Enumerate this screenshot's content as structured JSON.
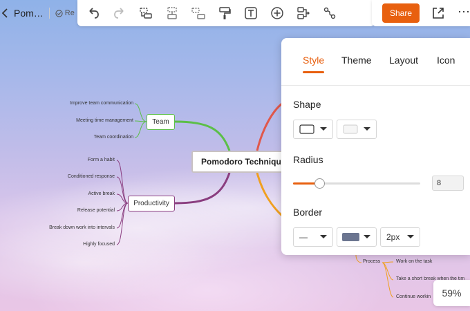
{
  "header": {
    "doc_title": "Pom…",
    "saved_status": "Re"
  },
  "toolbar": {
    "items": [
      "undo-icon",
      "redo-icon",
      "add-topic-icon",
      "add-subtopic-icon",
      "add-floating-topic-icon",
      "format-painter-icon",
      "text-icon",
      "insert-icon",
      "relationship-icon",
      "connector-icon"
    ],
    "share_label": "Share"
  },
  "colors": {
    "accent": "#e8600f",
    "team_branch": "#5cbf48",
    "productivity_branch": "#8a3d7f",
    "red_branch": "#e0584b",
    "orange_branch": "#f0a020"
  },
  "mindmap": {
    "central": "Pomodoro Techniqu",
    "team": {
      "label": "Team",
      "leaves": [
        "Improve team communication",
        "Meeting time management",
        "Team coordination"
      ]
    },
    "productivity": {
      "label": "Productivity",
      "leaves": [
        "Form a habit",
        "Conditioned response",
        "Active break",
        "Release potential",
        "Break down work into intervals",
        "Highly focused"
      ]
    },
    "process": {
      "label": "Process",
      "leaves": [
        "Work on the task",
        "Take a short break when the tim",
        "Continue workin"
      ]
    }
  },
  "panel": {
    "tabs": [
      "Style",
      "Theme",
      "Layout",
      "Icon"
    ],
    "active_tab": "Style",
    "shape_title": "Shape",
    "radius_title": "Radius",
    "radius_value": "8",
    "radius_fraction": 0.2,
    "border_title": "Border",
    "border_style": "—",
    "border_color": "#6b7590",
    "border_width": "2px"
  },
  "zoom": "59%"
}
